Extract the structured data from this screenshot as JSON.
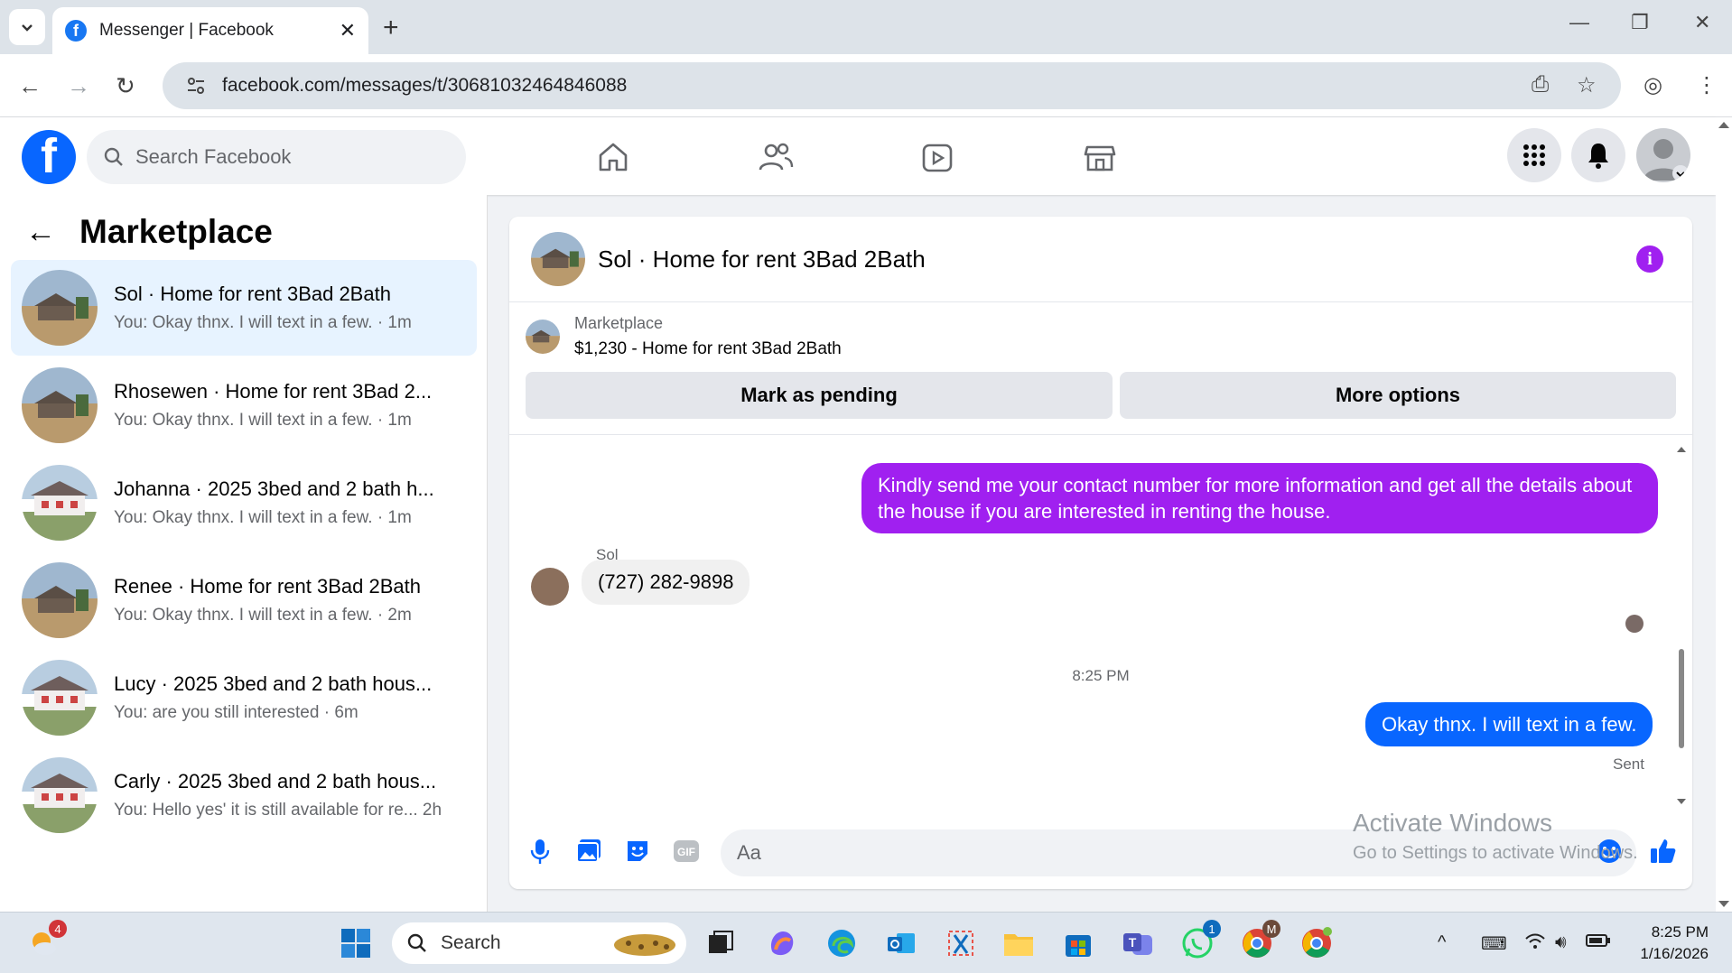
{
  "browser": {
    "tab_title": "Messenger | Facebook",
    "url": "facebook.com/messages/t/30681032464846088"
  },
  "fb": {
    "logo": "f",
    "search_placeholder": "Search Facebook"
  },
  "sidebar": {
    "title": "Marketplace",
    "conversations": [
      {
        "name": "Sol · Home for rent 3Bad 2Bath",
        "preview": "You: Okay thnx. I will text in a few. · 1m",
        "active": true
      },
      {
        "name": "Rhosewen · Home for rent 3Bad 2...",
        "preview": "You: Okay thnx. I will text in a few. · 1m"
      },
      {
        "name": "Johanna · 2025 3bed and 2 bath h...",
        "preview": "You: Okay thnx. I will text in a few. · 1m"
      },
      {
        "name": "Renee · Home for rent 3Bad 2Bath",
        "preview": "You: Okay thnx. I will text in a few. · 2m"
      },
      {
        "name": "Lucy · 2025 3bed and 2 bath hous...",
        "preview": "You: are you still interested · 6m"
      },
      {
        "name": "Carly · 2025 3bed and 2 bath hous...",
        "preview": "You: Hello yes' it is still available for re...  2h"
      }
    ]
  },
  "chat": {
    "header_name": "Sol · Home for rent 3Bad 2Bath",
    "info_glyph": "i",
    "marketplace_label": "Marketplace",
    "listing": "$1,230 - Home for rent 3Bad 2Bath",
    "mark_pending": "Mark as pending",
    "more_options": "More options",
    "messages": {
      "out1": "Kindly send me your contact number for more information and get all the details about the house if you are interested in renting the house.",
      "sender": "Sol",
      "in1": "(727) 282-9898",
      "time": "8:25 PM",
      "out2": "Okay thnx. I will text in a few.",
      "status": "Sent"
    },
    "composer_placeholder": "Aa"
  },
  "watermark": {
    "line1": "Activate Windows",
    "line2": "Go to Settings to activate Windows."
  },
  "taskbar": {
    "search_label": "Search",
    "time": "8:25 PM",
    "date": "1/16/2026",
    "badge_weather": "4",
    "badge_whatsapp": "1",
    "badge_chrome": "M"
  },
  "colors": {
    "fb_blue": "#0866ff",
    "purple_bubble": "#a020f0",
    "active_row": "#e7f3ff"
  }
}
